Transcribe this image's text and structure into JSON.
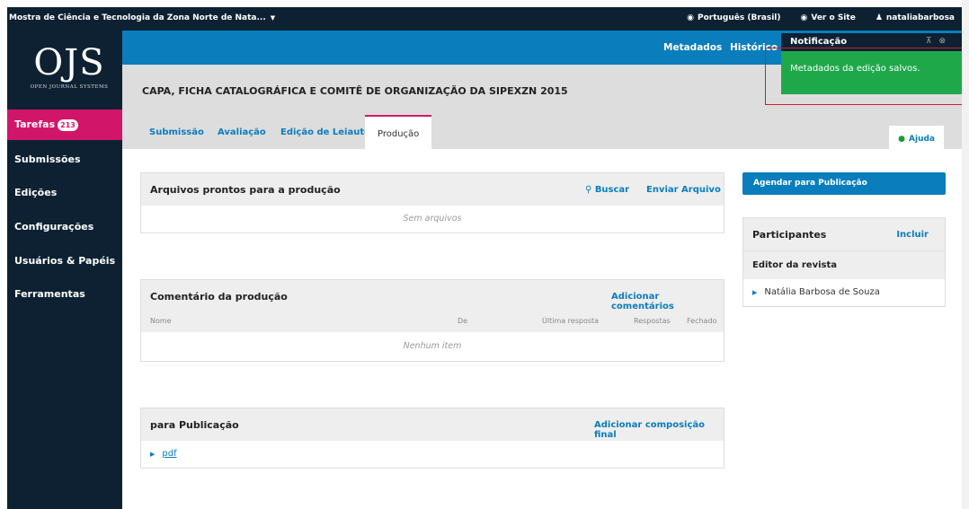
{
  "topbar": {
    "site_name": "Mostra de Ciência e Tecnologia da Zona Norte de Nata...",
    "language": "Português (Brasil)",
    "view_site": "Ver o Site",
    "username": "nataliabarbosa"
  },
  "logo": {
    "big": "OJS",
    "small": "OPEN JOURNAL SYSTEMS"
  },
  "sidebar": {
    "items": [
      {
        "label": "Tarefas",
        "badge": "213"
      },
      {
        "label": "Submissões"
      },
      {
        "label": "Edições"
      },
      {
        "label": "Configurações"
      },
      {
        "label": "Usuários & Papéis"
      },
      {
        "label": "Ferramentas"
      }
    ]
  },
  "header": {
    "metadata": "Metadados",
    "history": "Histórico Ed"
  },
  "page_title": "CAPA, FICHA CATALOGRÁFICA E COMITÊ DE ORGANIZAÇÃO DA SIPEXZN 2015",
  "tabs": [
    "Submissão",
    "Avaliação",
    "Edição de Leiaute",
    "Produção"
  ],
  "help": "Ajuda",
  "production_files": {
    "title": "Arquivos prontos para a produção",
    "search": "Buscar",
    "upload": "Enviar Arquivo",
    "empty": "Sem arquivos"
  },
  "production_discussion": {
    "title": "Comentário da produção",
    "add": "Adicionar comentários",
    "columns": [
      "Nome",
      "De",
      "Última resposta",
      "Respostas",
      "Fechado"
    ],
    "empty": "Nenhum item"
  },
  "publication": {
    "title": "para Publicação",
    "add": "Adicionar composição final",
    "items": [
      "pdf"
    ]
  },
  "schedule_button": "Agendar para Publicação",
  "participants": {
    "title": "Participantes",
    "add": "Incluir",
    "role": "Editor da revista",
    "people": [
      "Natália Barbosa de Souza"
    ]
  },
  "notification": {
    "title": "Notificação",
    "message": "Metadados da edição salvos."
  },
  "colors": {
    "navy": "#0d2132",
    "blue": "#0a7dbd",
    "magenta": "#d1166a",
    "success": "#1ea84a"
  }
}
